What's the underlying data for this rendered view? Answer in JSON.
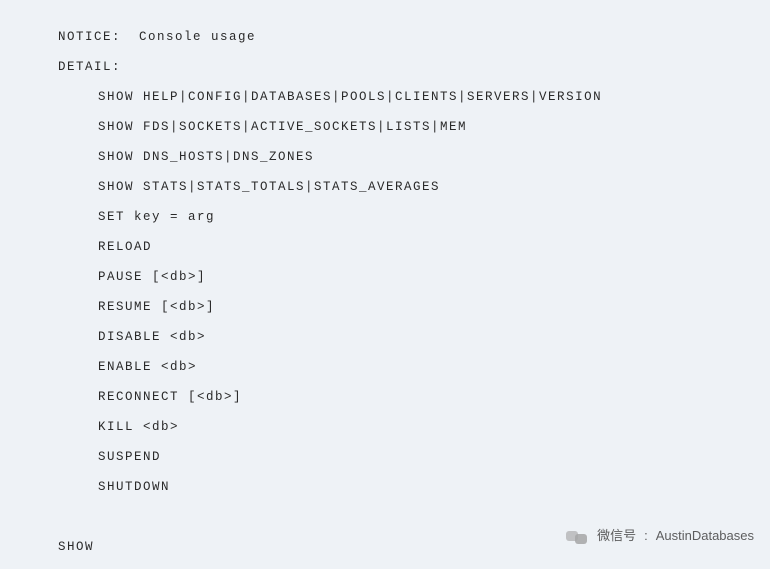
{
  "console": {
    "notice_label": "NOTICE:",
    "notice_text": "Console usage",
    "detail_label": "DETAIL:",
    "lines": [
      "SHOW HELP|CONFIG|DATABASES|POOLS|CLIENTS|SERVERS|VERSION",
      "SHOW FDS|SOCKETS|ACTIVE_SOCKETS|LISTS|MEM",
      "SHOW DNS_HOSTS|DNS_ZONES",
      "SHOW STATS|STATS_TOTALS|STATS_AVERAGES",
      "SET key = arg",
      "RELOAD",
      "PAUSE [<db>]",
      "RESUME [<db>]",
      "DISABLE <db>",
      "ENABLE <db>",
      "RECONNECT [<db>]",
      "KILL <db>",
      "SUSPEND",
      "SHUTDOWN"
    ],
    "footer": "SHOW"
  },
  "watermark": {
    "label": "微信号",
    "sep": ":",
    "value": "AustinDatabases"
  }
}
